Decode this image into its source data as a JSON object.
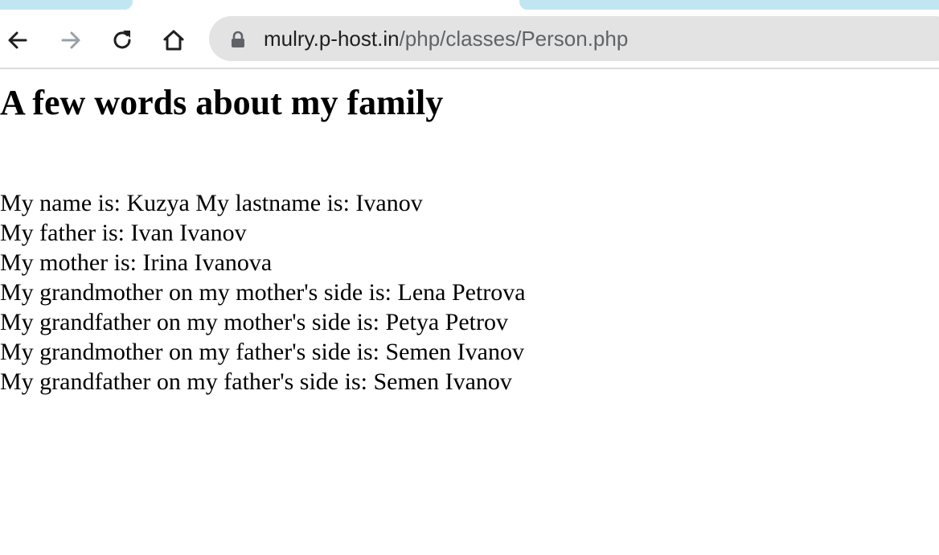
{
  "browser": {
    "nav": {
      "back_icon": "arrow-left-icon",
      "forward_icon": "arrow-right-icon",
      "reload_icon": "reload-icon",
      "home_icon": "home-icon"
    },
    "address_bar": {
      "host": "mulry.p-host.in",
      "path": "/php/classes/Person.php",
      "lock_icon": "lock-icon"
    },
    "colors": {
      "tab_accent": "#c2e6f1",
      "omnibox_bg": "#e3e3e3",
      "forward_disabled": "#9aa0a6"
    }
  },
  "page": {
    "title": "A few words about my family",
    "lines": [
      "My name is: Kuzya My lastname is: Ivanov",
      "My father is: Ivan Ivanov",
      "My mother is: Irina Ivanova",
      "My grandmother on my mother's side is: Lena Petrova",
      "My grandfather on my mother's side is: Petya Petrov",
      "My grandmother on my father's side is: Semen Ivanov",
      "My grandfather on my father's side is: Semen Ivanov"
    ]
  }
}
